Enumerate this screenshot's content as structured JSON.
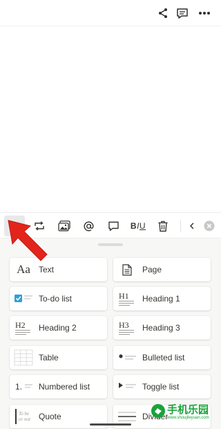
{
  "top_bar": {
    "faint_title": "",
    "icons": [
      "share-icon",
      "comment-icon",
      "more-icon"
    ]
  },
  "toolbar": {
    "buttons": [
      "plus-icon",
      "turn-into-icon",
      "image-icon",
      "mention-icon",
      "comment-icon",
      "biu-format",
      "trash-icon",
      "chevron-left-icon",
      "close-circle-icon"
    ],
    "biu_label": "BIU"
  },
  "block_menu": {
    "items": [
      {
        "label": "Text",
        "icon": "text-aa-icon",
        "icon_text": "Aa"
      },
      {
        "label": "Page",
        "icon": "page-icon"
      },
      {
        "label": "To-do list",
        "icon": "checkbox-icon"
      },
      {
        "label": "Heading 1",
        "icon": "heading1-icon",
        "icon_text": "H1"
      },
      {
        "label": "Heading 2",
        "icon": "heading2-icon",
        "icon_text": "H2"
      },
      {
        "label": "Heading 3",
        "icon": "heading3-icon",
        "icon_text": "H3"
      },
      {
        "label": "Table",
        "icon": "table-icon"
      },
      {
        "label": "Bulleted list",
        "icon": "bullet-list-icon"
      },
      {
        "label": "Numbered list",
        "icon": "numbered-list-icon",
        "icon_text": "1."
      },
      {
        "label": "Toggle list",
        "icon": "toggle-list-icon"
      },
      {
        "label": "Quote",
        "icon": "quote-icon",
        "icon_text": "To be or not"
      },
      {
        "label": "Divider",
        "icon": "divider-icon"
      }
    ]
  },
  "watermark": {
    "text": "手机乐园",
    "subtext": "www.shoujileyuan.com"
  },
  "colors": {
    "accent_blue": "#2e9fd9",
    "arrow_red": "#e3241b",
    "watermark_green": "#19a33a"
  }
}
